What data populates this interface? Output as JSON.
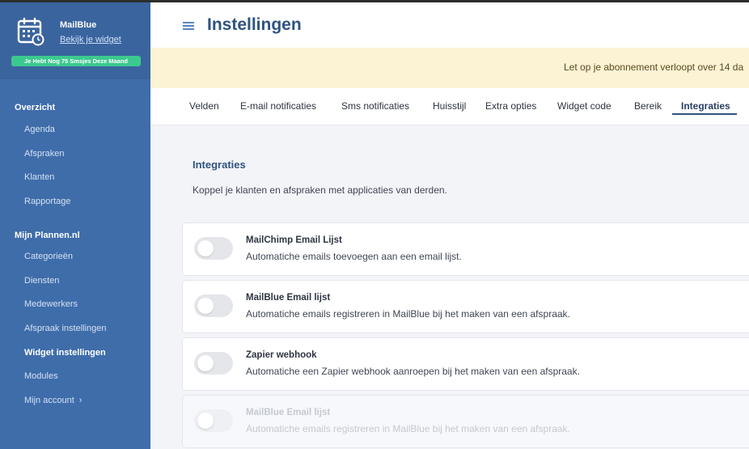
{
  "brand": {
    "name": "MailBlue",
    "link": "Bekijk je widget",
    "sms_badge": "Je Hebt Nog 75 Smsjes Deze Maand"
  },
  "sidebar": {
    "section1": "Overzicht",
    "items1": [
      "Agenda",
      "Afspraken",
      "Klanten",
      "Rapportage"
    ],
    "section2": "Mijn Plannen.nl",
    "items2": [
      "Categorieën",
      "Diensten",
      "Medewerkers",
      "Afspraak instellingen",
      "Widget instellingen",
      "Modules",
      "Mijn account"
    ]
  },
  "header": {
    "title": "Instellingen"
  },
  "notice": {
    "text": "Let op je abonnement verloopt over 14 da"
  },
  "tabs": [
    "Velden",
    "E-mail notificaties",
    "Sms notificaties",
    "Huisstijl",
    "Extra opties",
    "Widget code",
    "Bereik",
    "Integraties"
  ],
  "active_tab": "Integraties",
  "section": {
    "title": "Integraties",
    "description": "Koppel je klanten en afspraken met applicaties van derden."
  },
  "integrations": [
    {
      "title": "MailChimp Email Lijst",
      "description": "Automatiche emails toevoegen aan een email lijst.",
      "enabled": false,
      "disabled": false
    },
    {
      "title": "MailBlue Email lijst",
      "description": "Automatiche emails registreren in MailBlue bij het maken van een afspraak.",
      "enabled": false,
      "disabled": false
    },
    {
      "title": "Zapier webhook",
      "description": "Automatiche een Zapier webhook aanroepen bij het maken van een afspraak.",
      "enabled": false,
      "disabled": false
    },
    {
      "title": "MailBlue Email lijst",
      "description": "Automatiche emails registreren in MailBlue bij het maken van een afspraak.",
      "enabled": false,
      "disabled": true
    }
  ],
  "colors": {
    "sidebar": "#3f6daa",
    "accent": "#2f5381",
    "badge": "#3cc98f",
    "notice": "#fcf3d4"
  },
  "icons": {
    "brand": "calendar-icon",
    "menu": "hamburger-icon",
    "account": "chevron-right-icon"
  }
}
